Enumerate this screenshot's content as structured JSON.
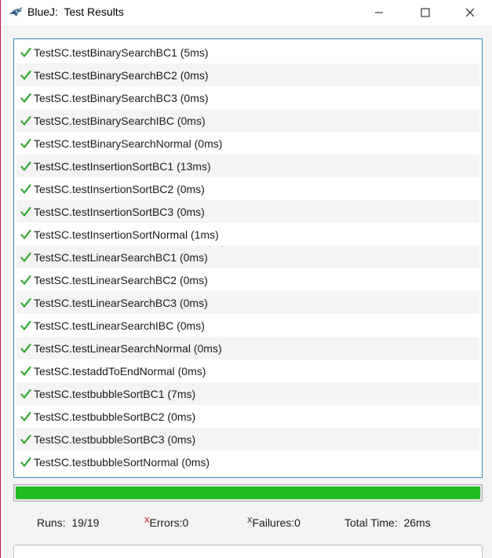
{
  "window": {
    "app_name": "BlueJ:",
    "title": "Test Results"
  },
  "icons": {
    "app": "bluej-bird-icon",
    "minimize": "minimize-icon",
    "maximize": "maximize-icon",
    "close": "close-icon",
    "pass": "green-check-icon"
  },
  "colors": {
    "accent_border": "#3a8fb7",
    "progress_green": "#1fbc1f",
    "error_red": "#d32020",
    "window_edge": "#c2185b"
  },
  "tests": [
    {
      "label": "TestSC.testBinarySearchBC1 (5ms)",
      "status": "pass"
    },
    {
      "label": "TestSC.testBinarySearchBC2 (0ms)",
      "status": "pass"
    },
    {
      "label": "TestSC.testBinarySearchBC3 (0ms)",
      "status": "pass"
    },
    {
      "label": "TestSC.testBinarySearchIBC (0ms)",
      "status": "pass"
    },
    {
      "label": "TestSC.testBinarySearchNormal (0ms)",
      "status": "pass"
    },
    {
      "label": "TestSC.testInsertionSortBC1 (13ms)",
      "status": "pass"
    },
    {
      "label": "TestSC.testInsertionSortBC2 (0ms)",
      "status": "pass"
    },
    {
      "label": "TestSC.testInsertionSortBC3 (0ms)",
      "status": "pass"
    },
    {
      "label": "TestSC.testInsertionSortNormal (1ms)",
      "status": "pass"
    },
    {
      "label": "TestSC.testLinearSearchBC1 (0ms)",
      "status": "pass"
    },
    {
      "label": "TestSC.testLinearSearchBC2 (0ms)",
      "status": "pass"
    },
    {
      "label": "TestSC.testLinearSearchBC3 (0ms)",
      "status": "pass"
    },
    {
      "label": "TestSC.testLinearSearchIBC (0ms)",
      "status": "pass"
    },
    {
      "label": "TestSC.testLinearSearchNormal (0ms)",
      "status": "pass"
    },
    {
      "label": "TestSC.testaddToEndNormal (0ms)",
      "status": "pass"
    },
    {
      "label": "TestSC.testbubbleSortBC1 (7ms)",
      "status": "pass"
    },
    {
      "label": "TestSC.testbubbleSortBC2 (0ms)",
      "status": "pass"
    },
    {
      "label": "TestSC.testbubbleSortBC3 (0ms)",
      "status": "pass"
    },
    {
      "label": "TestSC.testbubbleSortNormal (0ms)",
      "status": "pass"
    }
  ],
  "progress": {
    "fraction": 1.0
  },
  "stats": {
    "runs": "Runs:  19/19",
    "error_mark": "x",
    "errors": "Errors:0",
    "failure_mark": "x",
    "failures": "Failures:0",
    "total_time": "Total Time:  26ms"
  }
}
